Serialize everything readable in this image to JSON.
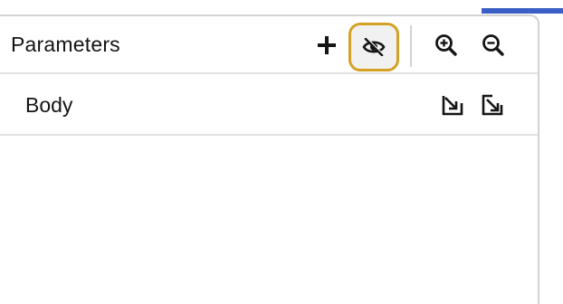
{
  "panel": {
    "title": "Parameters",
    "toolbar": {
      "add_icon": "plus-icon",
      "hide_icon": "eye-slash-icon",
      "zoom_in_icon": "zoom-in-icon",
      "zoom_out_icon": "zoom-out-icon"
    },
    "rows": [
      {
        "label": "Body",
        "actions": [
          "arrow-down-right-icon",
          "collapse-diagonal-icon"
        ]
      }
    ]
  },
  "colors": {
    "accent": "#3a60c8",
    "focus_ring": "#d4a125",
    "text": "#151515",
    "border": "#d2d2d2"
  }
}
